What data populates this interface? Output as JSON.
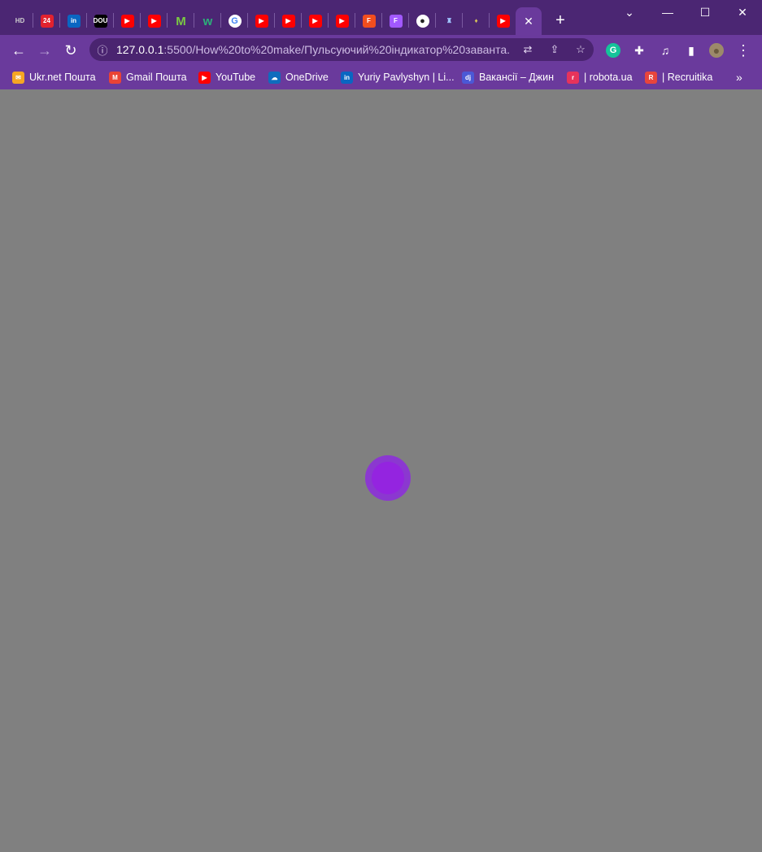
{
  "tabs": [
    {
      "icon": "hd-icon",
      "text": "HD",
      "bg": "transparent",
      "fg": "#cfcfcf"
    },
    {
      "icon": "24-icon",
      "text": "24",
      "bg": "#e2222e",
      "fg": "#ffffff"
    },
    {
      "icon": "linkedin-icon",
      "text": "in",
      "bg": "#0a66c2",
      "fg": "#ffffff"
    },
    {
      "icon": "dou-icon",
      "text": "DOU",
      "bg": "#000000",
      "fg": "#ffffff"
    },
    {
      "icon": "youtube-icon",
      "text": "▶",
      "bg": "#ff0000",
      "fg": "#ffffff"
    },
    {
      "icon": "youtube-icon",
      "text": "▶",
      "bg": "#ff0000",
      "fg": "#ffffff"
    },
    {
      "icon": "m-icon",
      "text": "M",
      "bg": "transparent",
      "fg": "#7ac943"
    },
    {
      "icon": "w-icon",
      "text": "w",
      "bg": "transparent",
      "fg": "#2cb07a"
    },
    {
      "icon": "google-icon",
      "text": "G",
      "bg": "#ffffff",
      "fg": "#4285f4"
    },
    {
      "icon": "youtube-icon",
      "text": "▶",
      "bg": "#ff0000",
      "fg": "#ffffff"
    },
    {
      "icon": "youtube-icon",
      "text": "▶",
      "bg": "#ff0000",
      "fg": "#ffffff"
    },
    {
      "icon": "youtube-icon",
      "text": "▶",
      "bg": "#ff0000",
      "fg": "#ffffff"
    },
    {
      "icon": "youtube-icon",
      "text": "▶",
      "bg": "#ff0000",
      "fg": "#ffffff"
    },
    {
      "icon": "figma-icon",
      "text": "F",
      "bg": "#f24e1e",
      "fg": "#ffffff"
    },
    {
      "icon": "figma-icon",
      "text": "F",
      "bg": "#a259ff",
      "fg": "#ffffff"
    },
    {
      "icon": "globe-icon",
      "text": "●",
      "bg": "#ffffff",
      "fg": "#222222"
    },
    {
      "icon": "castle-icon",
      "text": "♜",
      "bg": "transparent",
      "fg": "#9fc3ff"
    },
    {
      "icon": "emblem-icon",
      "text": "♦",
      "bg": "transparent",
      "fg": "#d6c35a"
    },
    {
      "icon": "youtube-icon",
      "text": "▶",
      "bg": "#ff0000",
      "fg": "#ffffff"
    }
  ],
  "active_tab": {
    "close_label": "✕"
  },
  "new_tab_label": "+",
  "window": {
    "minimize": "—",
    "maximize": "☐",
    "close": "✕",
    "dropdown": "⌄"
  },
  "toolbar": {
    "back": "←",
    "forward": "→",
    "reload": "↻",
    "info": "ⓘ"
  },
  "url": {
    "host": "127.0.0.1",
    "rest": ":5500/How%20to%20make/Пульсуючий%20індикатор%20заванта..."
  },
  "omnibox_icons": {
    "translate": "⇄",
    "share": "⇪",
    "star": "☆"
  },
  "extensions": {
    "grammarly": "G",
    "puzzle": "✚",
    "media": "♫",
    "sidepanel": "▮",
    "profile": "●",
    "menu": "⋮"
  },
  "bookmarks": [
    {
      "label": "Ukr.net Пошта",
      "icon": "ukrnet-icon",
      "glyph": "✉",
      "bg": "#f5a623"
    },
    {
      "label": "Gmail Пошта",
      "icon": "gmail-icon",
      "glyph": "M",
      "bg": "#ea4335"
    },
    {
      "label": "YouTube",
      "icon": "youtube-icon",
      "glyph": "▶",
      "bg": "#ff0000"
    },
    {
      "label": "OneDrive",
      "icon": "onedrive-icon",
      "glyph": "☁",
      "bg": "#0f6cbd"
    },
    {
      "label": "Yuriy Pavlyshyn | Li...",
      "icon": "linkedin-icon",
      "glyph": "in",
      "bg": "#0a66c2"
    },
    {
      "label": "Вакансії – Джин",
      "icon": "djinni-icon",
      "glyph": "dj",
      "bg": "#4b58d6"
    },
    {
      "label": "| robota.ua",
      "icon": "robota-icon",
      "glyph": "r",
      "bg": "#e6335b"
    },
    {
      "label": "| Recruitika",
      "icon": "recruitika-icon",
      "glyph": "R",
      "bg": "#e8453c"
    }
  ],
  "bookmarks_overflow": "»",
  "colors": {
    "tabbar": "#4b2673",
    "toolbar": "#6a3a9c",
    "content": "#808080",
    "loader_outer": "#8b38d0",
    "loader_inner": "#9424e0"
  }
}
